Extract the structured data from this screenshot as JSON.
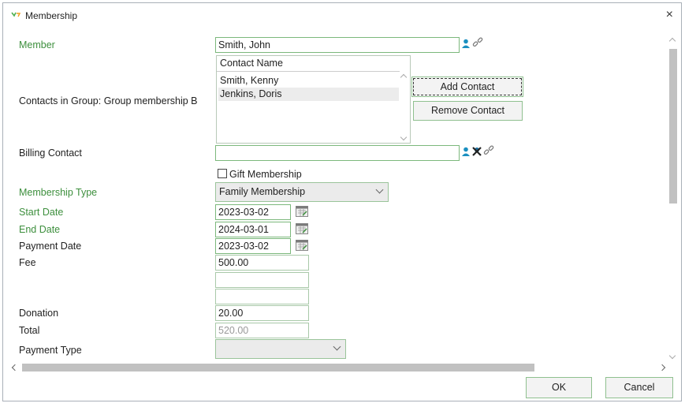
{
  "window": {
    "title": "Membership",
    "close_glyph": "×"
  },
  "form": {
    "member": {
      "label": "Member",
      "value": "Smith, John"
    },
    "contacts": {
      "label": "Contacts in Group: Group membership B",
      "column_header": "Contact Name",
      "rows": [
        "Smith, Kenny",
        "Jenkins, Doris"
      ],
      "selected_row": "Jenkins, Doris",
      "add_button": "Add Contact",
      "remove_button": "Remove Contact"
    },
    "billing_contact": {
      "label": "Billing Contact",
      "value": ""
    },
    "gift_membership": {
      "label": "Gift Membership",
      "checked": false
    },
    "membership_type": {
      "label": "Membership Type",
      "value": "Family Membership"
    },
    "start_date": {
      "label": "Start Date",
      "value": "2023-03-02"
    },
    "end_date": {
      "label": "End Date",
      "value": "2024-03-01"
    },
    "payment_date": {
      "label": "Payment Date",
      "value": "2023-03-02"
    },
    "fee": {
      "label": "Fee",
      "value": "500.00"
    },
    "extra_field_1": {
      "value": ""
    },
    "extra_field_2": {
      "value": ""
    },
    "donation": {
      "label": "Donation",
      "value": "20.00"
    },
    "total": {
      "label": "Total",
      "value": "520.00"
    },
    "payment_type": {
      "label": "Payment Type",
      "value": ""
    }
  },
  "footer": {
    "ok_button": "OK",
    "cancel_button": "Cancel"
  },
  "icons": [
    "app-logo-icon",
    "person-icon",
    "link-icon",
    "remove-icon",
    "calendar-icon"
  ],
  "colors": {
    "accent_green": "#3d8f3d",
    "person_blue": "#1a8fc0",
    "border_green": "#7cb87c"
  }
}
